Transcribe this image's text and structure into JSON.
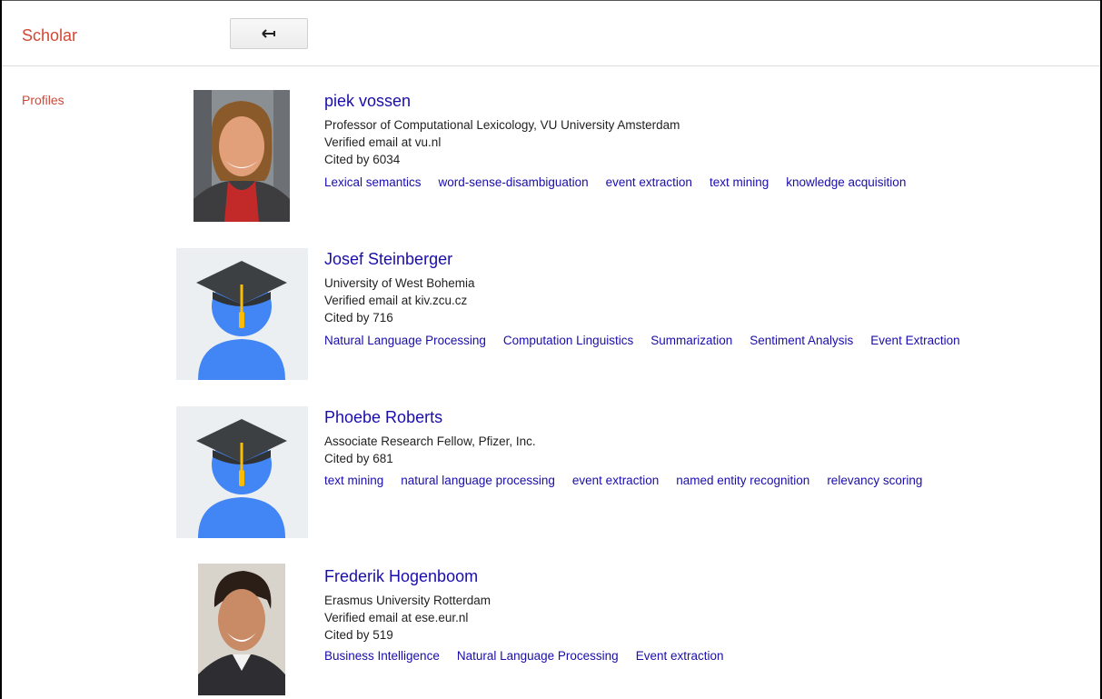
{
  "header": {
    "logo": "Scholar",
    "back_icon": "back-arrow-icon"
  },
  "sidebar": {
    "items": [
      {
        "label": "Profiles"
      }
    ]
  },
  "profiles": [
    {
      "name": "piek vossen",
      "affiliation": "Professor of Computational Lexicology, VU University Amsterdam",
      "email": "Verified email at vu.nl",
      "cited": "Cited by 6034",
      "tags": [
        "Lexical semantics",
        "word-sense-disambiguation",
        "event extraction",
        "text mining",
        "knowledge acquisition"
      ],
      "photo": "photo"
    },
    {
      "name": "Josef Steinberger",
      "affiliation": "University of West Bohemia",
      "email": "Verified email at kiv.zcu.cz",
      "cited": "Cited by 716",
      "tags": [
        "Natural Language Processing",
        "Computation Linguistics",
        "Summarization",
        "Sentiment Analysis",
        "Event Extraction"
      ],
      "photo": "default-avatar-icon"
    },
    {
      "name": "Phoebe Roberts",
      "affiliation": "Associate Research Fellow, Pfizer, Inc.",
      "cited": "Cited by 681",
      "tags": [
        "text mining",
        "natural language processing",
        "event extraction",
        "named entity recognition",
        "relevancy scoring"
      ],
      "photo": "default-avatar-icon"
    },
    {
      "name": "Frederik Hogenboom",
      "affiliation": "Erasmus University Rotterdam",
      "email": "Verified email at ese.eur.nl",
      "cited": "Cited by 519",
      "tags": [
        "Business Intelligence",
        "Natural Language Processing",
        "Event extraction"
      ],
      "photo": "photo"
    }
  ],
  "colors": {
    "brand": "#d14836",
    "link": "#1a0dab",
    "avatar_blue": "#4285f4",
    "cap": "#3c4043",
    "tassel": "#fbbc04"
  }
}
